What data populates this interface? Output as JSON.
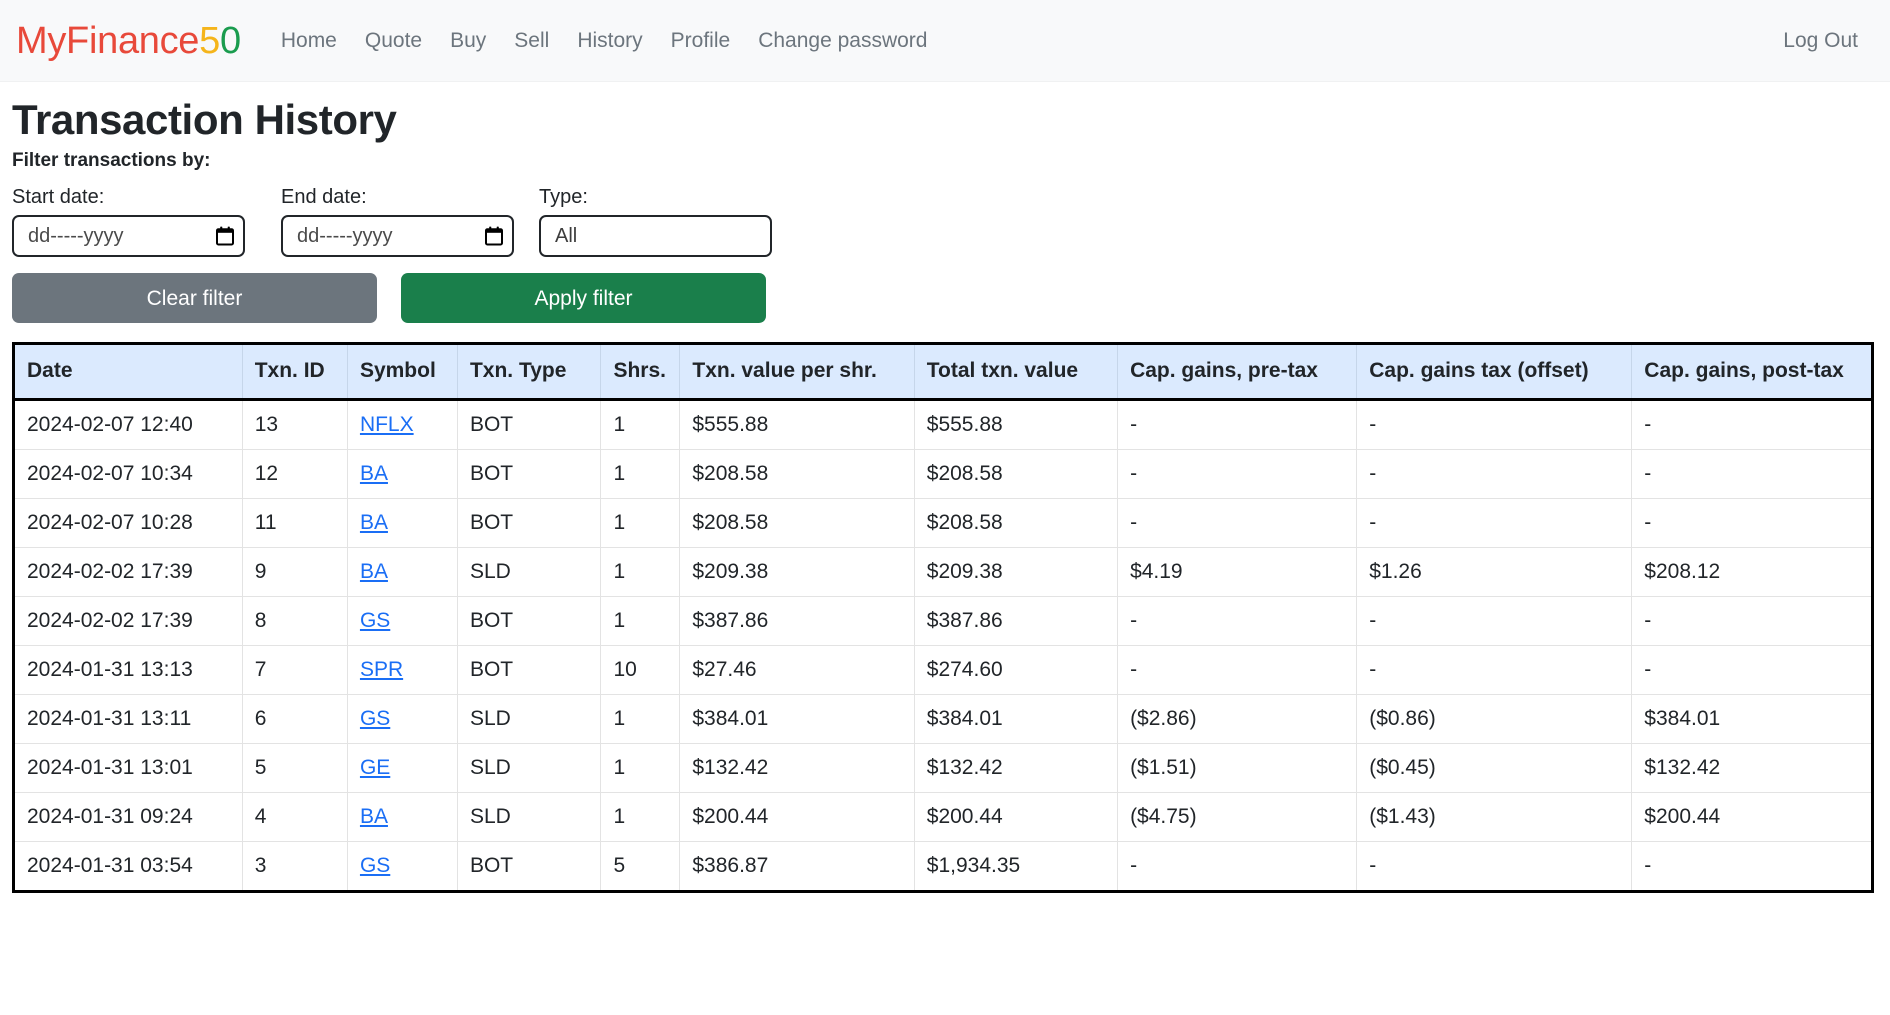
{
  "brand": {
    "part_red": "MyFinance",
    "part_gold": "5",
    "part_green": "0"
  },
  "nav": {
    "links": [
      {
        "label": "Home"
      },
      {
        "label": "Quote"
      },
      {
        "label": "Buy"
      },
      {
        "label": "Sell"
      },
      {
        "label": "History"
      },
      {
        "label": "Profile"
      },
      {
        "label": "Change password"
      }
    ],
    "logout_label": "Log Out"
  },
  "page": {
    "title": "Transaction History",
    "filter_caption": "Filter transactions by:"
  },
  "filters": {
    "start_date": {
      "label": "Start date:",
      "value": "",
      "placeholder": "dd-----yyyy",
      "icon": "calendar-icon"
    },
    "end_date": {
      "label": "End date:",
      "value": "",
      "placeholder": "dd-----yyyy",
      "icon": "calendar-icon"
    },
    "type": {
      "label": "Type:",
      "value": "All",
      "options": [
        "All"
      ]
    },
    "clear_button": "Clear filter",
    "apply_button": "Apply filter"
  },
  "colors": {
    "brand_red": "#e8493a",
    "brand_gold": "#f5b51b",
    "brand_green": "#1a9c4e",
    "navbar_bg": "#f8f9fa",
    "table_header_bg": "#dbeafe",
    "apply_button_bg": "#1a7f4b",
    "clear_button_bg": "#6c757d",
    "link_blue": "#1a6ef5"
  },
  "table": {
    "headers": [
      "Date",
      "Txn. ID",
      "Symbol",
      "Txn. Type",
      "Shrs.",
      "Txn. value per shr.",
      "Total txn. value",
      "Cap. gains, pre-tax",
      "Cap. gains tax (offset)",
      "Cap. gains, post-tax"
    ],
    "rows": [
      {
        "date": "2024-02-07 12:40",
        "txn_id": "13",
        "symbol": "NFLX",
        "txn_type": "BOT",
        "shares": "1",
        "value_per_share": "$555.88",
        "total_value": "$555.88",
        "gains_pre_tax": "-",
        "gains_tax": "-",
        "gains_post_tax": "-"
      },
      {
        "date": "2024-02-07 10:34",
        "txn_id": "12",
        "symbol": "BA",
        "txn_type": "BOT",
        "shares": "1",
        "value_per_share": "$208.58",
        "total_value": "$208.58",
        "gains_pre_tax": "-",
        "gains_tax": "-",
        "gains_post_tax": "-"
      },
      {
        "date": "2024-02-07 10:28",
        "txn_id": "11",
        "symbol": "BA",
        "txn_type": "BOT",
        "shares": "1",
        "value_per_share": "$208.58",
        "total_value": "$208.58",
        "gains_pre_tax": "-",
        "gains_tax": "-",
        "gains_post_tax": "-"
      },
      {
        "date": "2024-02-02 17:39",
        "txn_id": "9",
        "symbol": "BA",
        "txn_type": "SLD",
        "shares": "1",
        "value_per_share": "$209.38",
        "total_value": "$209.38",
        "gains_pre_tax": "$4.19",
        "gains_tax": "$1.26",
        "gains_post_tax": "$208.12"
      },
      {
        "date": "2024-02-02 17:39",
        "txn_id": "8",
        "symbol": "GS",
        "txn_type": "BOT",
        "shares": "1",
        "value_per_share": "$387.86",
        "total_value": "$387.86",
        "gains_pre_tax": "-",
        "gains_tax": "-",
        "gains_post_tax": "-"
      },
      {
        "date": "2024-01-31 13:13",
        "txn_id": "7",
        "symbol": "SPR",
        "txn_type": "BOT",
        "shares": "10",
        "value_per_share": "$27.46",
        "total_value": "$274.60",
        "gains_pre_tax": "-",
        "gains_tax": "-",
        "gains_post_tax": "-"
      },
      {
        "date": "2024-01-31 13:11",
        "txn_id": "6",
        "symbol": "GS",
        "txn_type": "SLD",
        "shares": "1",
        "value_per_share": "$384.01",
        "total_value": "$384.01",
        "gains_pre_tax": "($2.86)",
        "gains_tax": "($0.86)",
        "gains_post_tax": "$384.01"
      },
      {
        "date": "2024-01-31 13:01",
        "txn_id": "5",
        "symbol": "GE",
        "txn_type": "SLD",
        "shares": "1",
        "value_per_share": "$132.42",
        "total_value": "$132.42",
        "gains_pre_tax": "($1.51)",
        "gains_tax": "($0.45)",
        "gains_post_tax": "$132.42"
      },
      {
        "date": "2024-01-31 09:24",
        "txn_id": "4",
        "symbol": "BA",
        "txn_type": "SLD",
        "shares": "1",
        "value_per_share": "$200.44",
        "total_value": "$200.44",
        "gains_pre_tax": "($4.75)",
        "gains_tax": "($1.43)",
        "gains_post_tax": "$200.44"
      },
      {
        "date": "2024-01-31 03:54",
        "txn_id": "3",
        "symbol": "GS",
        "txn_type": "BOT",
        "shares": "5",
        "value_per_share": "$386.87",
        "total_value": "$1,934.35",
        "gains_pre_tax": "-",
        "gains_tax": "-",
        "gains_post_tax": "-"
      }
    ]
  }
}
